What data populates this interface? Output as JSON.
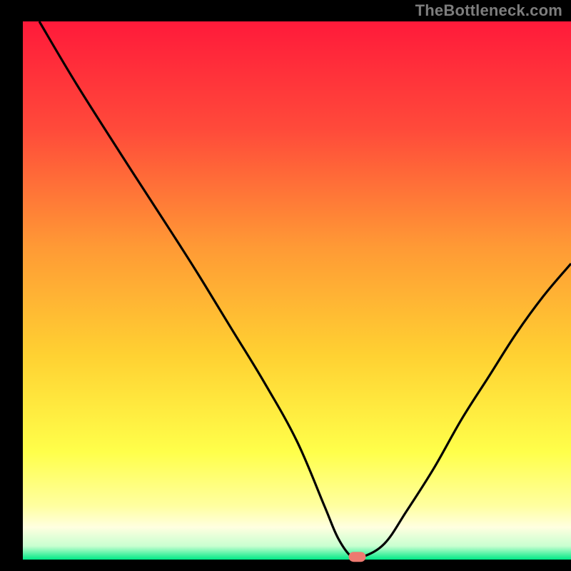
{
  "watermark": "TheBottleneck.com",
  "chart_data": {
    "type": "line",
    "title": "",
    "xlabel": "",
    "ylabel": "",
    "xlim": [
      0,
      100
    ],
    "ylim": [
      0,
      100
    ],
    "background": {
      "type": "vertical-gradient",
      "stops": [
        {
          "pos": 0.0,
          "color": "#ff1a3a"
        },
        {
          "pos": 0.2,
          "color": "#ff4a3a"
        },
        {
          "pos": 0.42,
          "color": "#ff9a35"
        },
        {
          "pos": 0.62,
          "color": "#ffd132"
        },
        {
          "pos": 0.8,
          "color": "#ffff4a"
        },
        {
          "pos": 0.9,
          "color": "#ffffa0"
        },
        {
          "pos": 0.94,
          "color": "#ffffe0"
        },
        {
          "pos": 0.975,
          "color": "#c8ffd0"
        },
        {
          "pos": 1.0,
          "color": "#00e987"
        }
      ]
    },
    "series": [
      {
        "name": "bottleneck-curve",
        "color": "#000000",
        "x": [
          3,
          10,
          20,
          27,
          32,
          38,
          44,
          50,
          55,
          57.5,
          60,
          62,
          66,
          70,
          75,
          80,
          85,
          90,
          95,
          100
        ],
        "y": [
          100,
          88,
          72,
          61,
          53,
          43,
          33,
          22,
          10,
          4,
          0.5,
          0.5,
          3,
          9,
          17,
          26,
          34,
          42,
          49,
          55
        ]
      }
    ],
    "marker": {
      "name": "optimum-marker",
      "x": 61,
      "y": 0.5,
      "color": "#ed7a70",
      "shape": "rounded-rect"
    }
  }
}
